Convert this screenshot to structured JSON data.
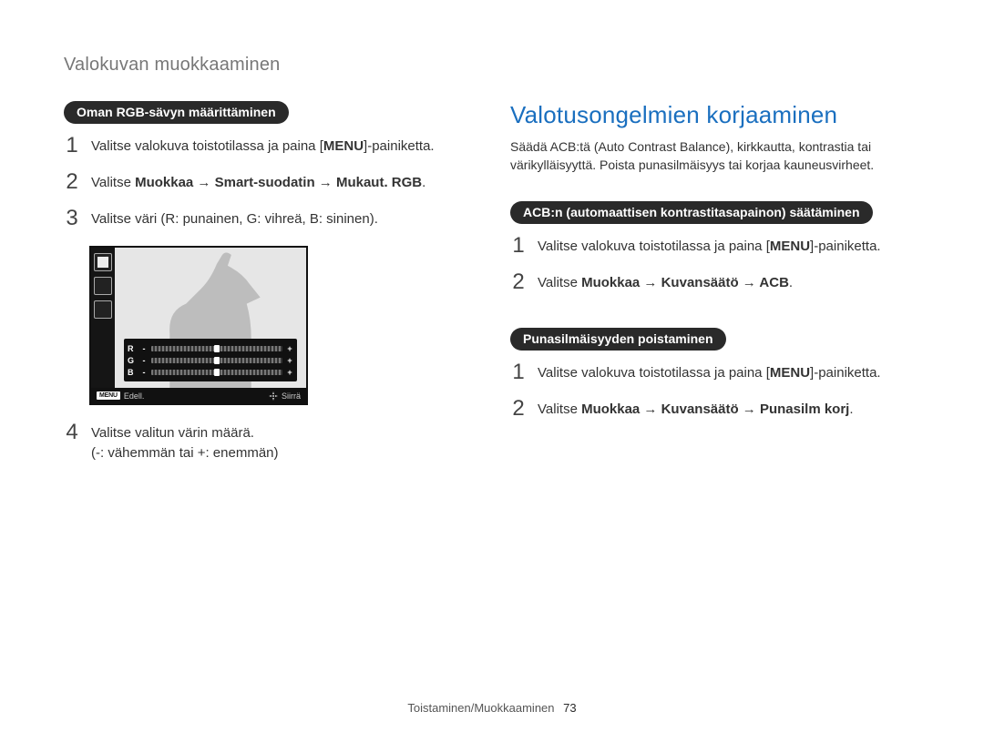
{
  "header": "Valokuvan muokkaaminen",
  "left": {
    "pill": "Oman RGB-sävyn määrittäminen",
    "s1_a": "Valitse valokuva toistotilassa ja paina [",
    "s1_b": "MENU",
    "s1_c": "]-painiketta.",
    "s2_a": "Valitse ",
    "s2_b": "Muokkaa → Smart-suodatin → Mukaut. RGB",
    "s2_c": ".",
    "s3": "Valitse väri (R: punainen, G: vihreä, B: sininen).",
    "s4_a": "Valitse valitun värin määrä.",
    "s4_b": "(-: vähemmän tai +: enemmän)"
  },
  "screen": {
    "r": "R",
    "g": "G",
    "b": "B",
    "minus": "-",
    "plus": "+",
    "menu": "MENU",
    "back": "Edell.",
    "move": "Siirrä"
  },
  "right": {
    "title": "Valotusongelmien korjaaminen",
    "intro": "Säädä ACB:tä (Auto Contrast Balance), kirkkautta, kontrastia tai värikylläisyyttä. Poista punasilmäisyys tai korjaa kauneusvirheet.",
    "acb": {
      "pill": "ACB:n (automaattisen kontrastitasapainon) säätäminen",
      "s1_a": "Valitse valokuva toistotilassa ja paina [",
      "s1_b": "MENU",
      "s1_c": "]-painiketta.",
      "s2_a": "Valitse ",
      "s2_b": "Muokkaa → Kuvansäätö → ACB",
      "s2_c": "."
    },
    "redeye": {
      "pill": "Punasilmäisyyden poistaminen",
      "s1_a": "Valitse valokuva toistotilassa ja paina [",
      "s1_b": "MENU",
      "s1_c": "]-painiketta.",
      "s2_a": "Valitse ",
      "s2_b": "Muokkaa → Kuvansäätö → Punasilm korj",
      "s2_c": "."
    }
  },
  "footer": {
    "section": "Toistaminen/Muokkaaminen",
    "page": "73"
  }
}
